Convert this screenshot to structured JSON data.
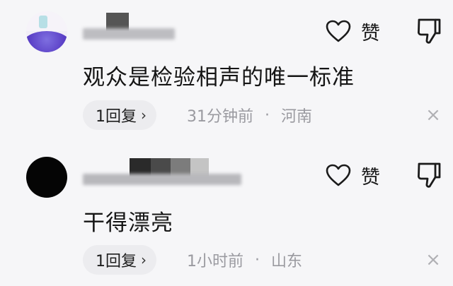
{
  "comments": [
    {
      "text": "观众是检验相声的唯一标准",
      "like_label": "赞",
      "reply_label": "1回复",
      "reply_chevron": "›",
      "time": "31分钟前",
      "separator": "·",
      "location": "河南",
      "close_glyph": "×"
    },
    {
      "text": "干得漂亮",
      "like_label": "赞",
      "reply_label": "1回复",
      "reply_chevron": "›",
      "time": "1小时前",
      "separator": "·",
      "location": "山东",
      "close_glyph": "×"
    }
  ],
  "icons": {
    "like": "heart-outline-icon",
    "dislike": "thumbs-down-icon",
    "close": "close-icon"
  },
  "colors": {
    "background": "#f6f6f8",
    "reply_pill": "#ececef",
    "meta_text": "#9a9aa0",
    "primary_text": "#151515"
  }
}
